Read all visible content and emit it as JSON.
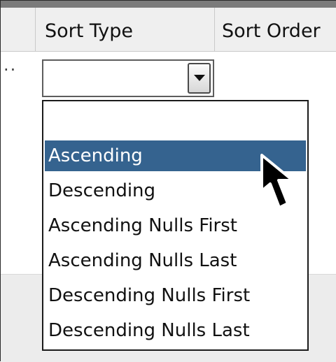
{
  "header": {
    "columns": [
      {
        "label": "Sort Type"
      },
      {
        "label": "Sort Order"
      }
    ]
  },
  "row": {
    "marker": "..",
    "sort_type_value": ""
  },
  "dropdown": {
    "options": [
      {
        "label": ""
      },
      {
        "label": "Ascending",
        "selected": true
      },
      {
        "label": "Descending"
      },
      {
        "label": "Ascending Nulls First"
      },
      {
        "label": "Ascending Nulls Last"
      },
      {
        "label": "Descending Nulls First"
      },
      {
        "label": "Descending Nulls Last"
      }
    ]
  },
  "colors": {
    "selection": "#35638f",
    "header_bg": "#efefef",
    "gray_area": "#ececec"
  },
  "icons": {
    "cursor": "arrow-cursor-icon",
    "dropdown": "chevron-down-icon"
  }
}
